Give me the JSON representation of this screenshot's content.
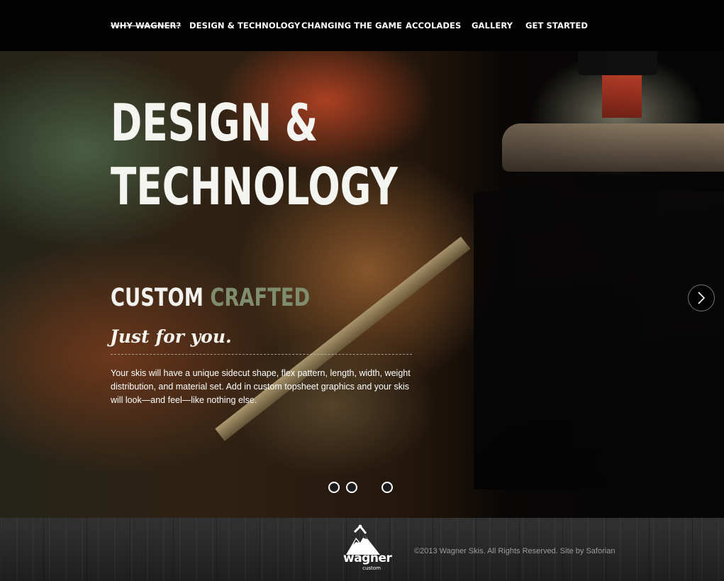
{
  "nav": {
    "items": [
      {
        "label": "WHY WAGNER?"
      },
      {
        "label": "DESIGN & TECHNOLOGY"
      },
      {
        "label": "CHANGING THE GAME"
      },
      {
        "label": "ACCOLADES"
      },
      {
        "label": "GALLERY"
      },
      {
        "label": "GET STARTED"
      }
    ]
  },
  "hero": {
    "title_line1": "DESIGN &",
    "title_line2": "TECHNOLOGY",
    "subtitle_part1": "CUSTOM",
    "subtitle_part2": "CRAFTED",
    "tagline": "Just for you.",
    "description": "Your skis will have a unique sidecut shape, flex pattern, length, width, weight distribution, and material set. Add in custom topsheet graphics and your skis will look—and feel—like nothing else.",
    "next_icon": "chevron-right-icon",
    "slides_total": 4,
    "slide_active": 3
  },
  "footer": {
    "logo_word": "wagner",
    "logo_sub": "custom",
    "copyright": "©2013 Wagner Skis. All Rights Reserved. Site by Saforian"
  },
  "colors": {
    "nav_bg": "#030303",
    "accent_green": "#7f8d6e",
    "footer_text": "#9c9c9c"
  }
}
